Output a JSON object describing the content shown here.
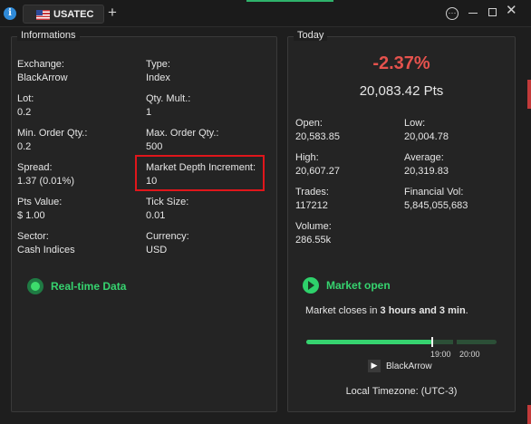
{
  "window": {
    "tab_label": "USATEC",
    "add_tab_glyph": "+",
    "info_glyph": "i",
    "menu_glyph": "···",
    "close_glyph": "✕",
    "accent_color": "#2fb36b"
  },
  "informations": {
    "title": "Informations",
    "fields": {
      "exchange": {
        "label": "Exchange:",
        "value": "BlackArrow"
      },
      "type": {
        "label": "Type:",
        "value": "Index"
      },
      "lot": {
        "label": "Lot:",
        "value": "0.2"
      },
      "qty_mult": {
        "label": "Qty. Mult.:",
        "value": "1"
      },
      "min_order": {
        "label": "Min. Order Qty.:",
        "value": "0.2"
      },
      "max_order": {
        "label": "Max. Order Qty.:",
        "value": "500"
      },
      "spread": {
        "label": "Spread:",
        "value": "1.37 (0.01%)"
      },
      "depth_increment": {
        "label": "Market Depth Increment:",
        "value": "10"
      },
      "pts_value": {
        "label": "Pts Value:",
        "value": "$ 1.00"
      },
      "tick_size": {
        "label": "Tick Size:",
        "value": "0.01"
      },
      "sector": {
        "label": "Sector:",
        "value": "Cash Indices"
      },
      "currency": {
        "label": "Currency:",
        "value": "USD"
      }
    },
    "status": {
      "label": "Real-time Data",
      "icon": "live-dot-icon",
      "color": "#36d36f"
    }
  },
  "today": {
    "title": "Today",
    "change": "-2.37%",
    "change_color": "#e5524d",
    "price": "20,083.42 Pts",
    "stats": {
      "open": {
        "label": "Open:",
        "value": "20,583.85"
      },
      "low": {
        "label": "Low:",
        "value": "20,004.78"
      },
      "high": {
        "label": "High:",
        "value": "20,607.27"
      },
      "average": {
        "label": "Average:",
        "value": "20,319.83"
      },
      "trades": {
        "label": "Trades:",
        "value": "117212"
      },
      "financial_vol": {
        "label": "Financial Vol:",
        "value": "5,845,055,683"
      },
      "volume": {
        "label": "Volume:",
        "value": "286.55k"
      }
    },
    "market_status": "Market open",
    "market_status_icon": "play-icon",
    "closes_prefix": "Market closes in ",
    "closes_time": "3 hours and 3 min",
    "closes_suffix": ".",
    "session_progress_fraction": 0.66,
    "session_ticks": [
      "19:00",
      "20:00"
    ],
    "broker": "BlackArrow",
    "timezone": "Local Timezone: (UTC-3)"
  }
}
